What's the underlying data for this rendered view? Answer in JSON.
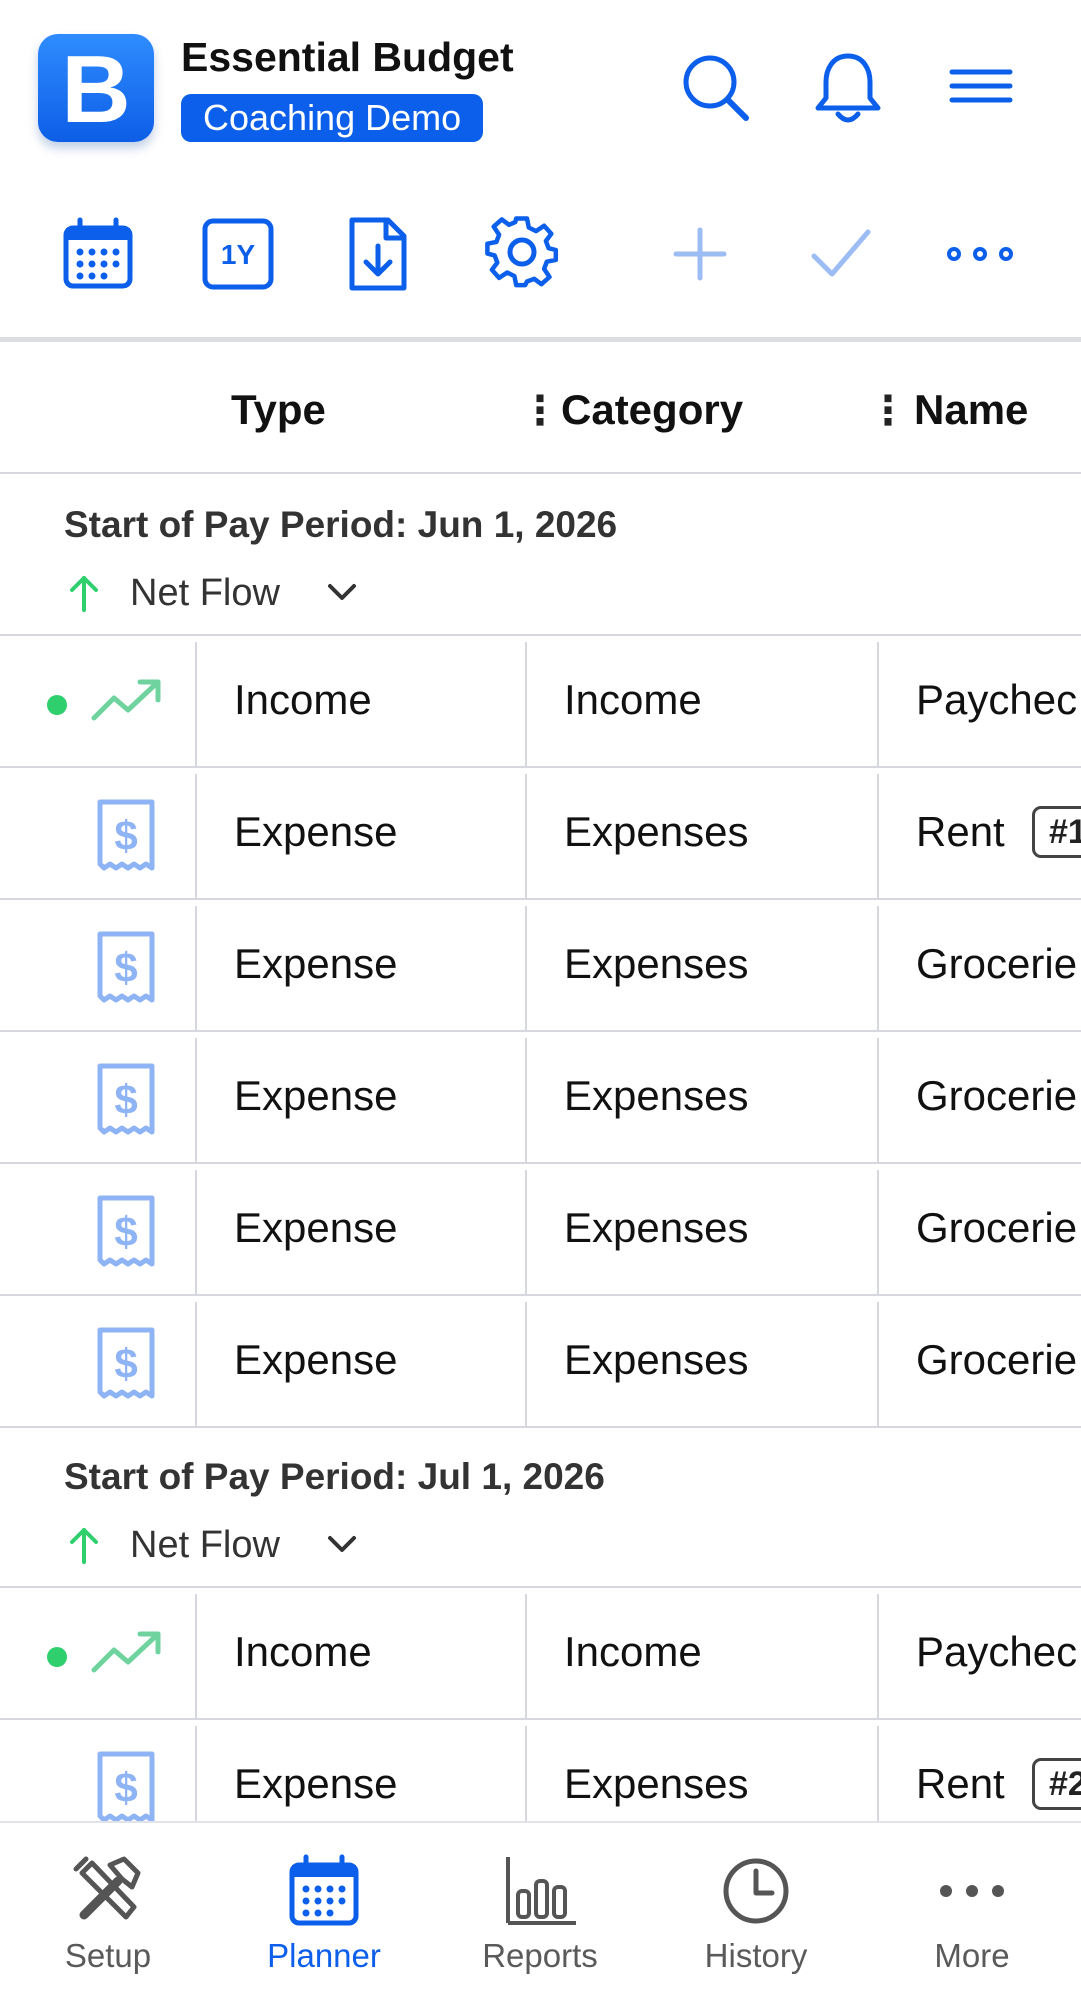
{
  "app": {
    "title": "Essential Budget",
    "badge": "Coaching Demo",
    "logo_letter": "B"
  },
  "header_icons": [
    "search-icon",
    "bell-icon",
    "menu-icon"
  ],
  "toolbar": {
    "icons": [
      "calendar-icon",
      "one-year-icon",
      "download-file-icon",
      "gear-icon",
      "plus-icon",
      "checkmark-icon",
      "more-icon"
    ],
    "one_year_label": "1Y"
  },
  "columns": {
    "type": "Type",
    "category": "Category",
    "name": "Name"
  },
  "periods": [
    {
      "title": "Start of Pay Period: Jun 1, 2026",
      "net_flow_label": "Net Flow",
      "rows": [
        {
          "kind": "income",
          "type": "Income",
          "category": "Income",
          "name": "Paychec",
          "tag": ""
        },
        {
          "kind": "expense",
          "type": "Expense",
          "category": "Expenses",
          "name": "Rent",
          "tag": "#1"
        },
        {
          "kind": "expense",
          "type": "Expense",
          "category": "Expenses",
          "name": "Grocerie",
          "tag": ""
        },
        {
          "kind": "expense",
          "type": "Expense",
          "category": "Expenses",
          "name": "Grocerie",
          "tag": ""
        },
        {
          "kind": "expense",
          "type": "Expense",
          "category": "Expenses",
          "name": "Grocerie",
          "tag": ""
        },
        {
          "kind": "expense",
          "type": "Expense",
          "category": "Expenses",
          "name": "Grocerie",
          "tag": ""
        }
      ]
    },
    {
      "title": "Start of Pay Period: Jul 1, 2026",
      "net_flow_label": "Net Flow",
      "rows": [
        {
          "kind": "income",
          "type": "Income",
          "category": "Income",
          "name": "Paychec",
          "tag": ""
        },
        {
          "kind": "expense",
          "type": "Expense",
          "category": "Expenses",
          "name": "Rent",
          "tag": "#2"
        }
      ]
    }
  ],
  "bottom_nav": [
    {
      "label": "Setup",
      "icon": "tools-icon",
      "active": false
    },
    {
      "label": "Planner",
      "icon": "calendar-icon",
      "active": true
    },
    {
      "label": "Reports",
      "icon": "bar-chart-icon",
      "active": false
    },
    {
      "label": "History",
      "icon": "clock-icon",
      "active": false
    },
    {
      "label": "More",
      "icon": "more-icon",
      "active": false
    }
  ],
  "colors": {
    "accent": "#0b5fea",
    "income_green": "#2fcf6e",
    "expense_icon": "#8fb4f5",
    "disabled_icon": "#9cbcf4"
  }
}
